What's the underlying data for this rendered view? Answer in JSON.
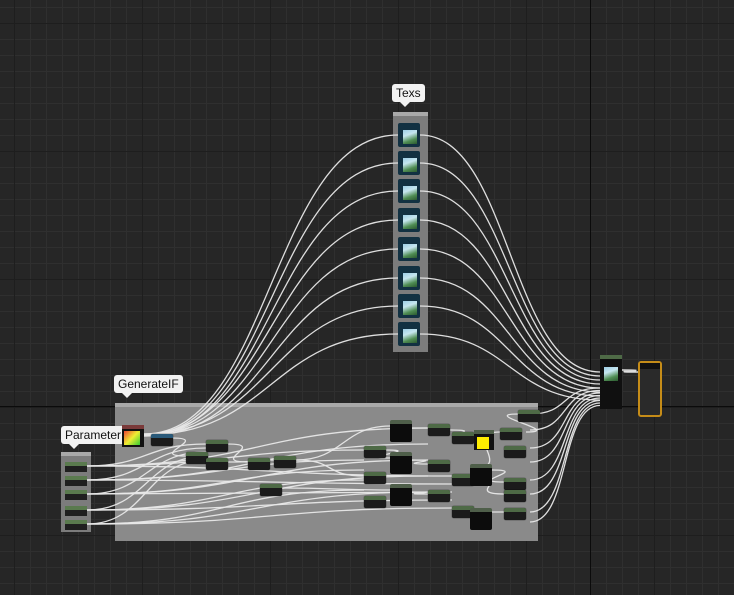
{
  "comments": {
    "texs": "Texs",
    "generate": "GenerateIF",
    "parameter": "Parameter"
  },
  "colors": {
    "wire": "#e8e8e8",
    "yellow_const": "#ffee00",
    "output_border": "#c58c18"
  },
  "icons": {
    "texture_sample": "texture-thumbnail-icon",
    "gradient": "color-gradient-icon"
  }
}
